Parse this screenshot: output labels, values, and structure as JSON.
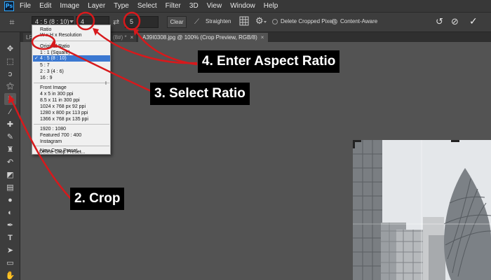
{
  "app": {
    "logo": "Ps"
  },
  "menubar": {
    "items": [
      "File",
      "Edit",
      "Image",
      "Layer",
      "Type",
      "Select",
      "Filter",
      "3D",
      "View",
      "Window",
      "Help"
    ]
  },
  "options": {
    "ratio_value": "4 : 5 (8 : 10)",
    "width_value": "4",
    "height_value": "5",
    "clear_label": "Clear",
    "straighten_label": "Straighten",
    "delete_cropped_label": "Delete Cropped Pixels",
    "content_aware_label": "Content-Aware"
  },
  "tabs": [
    {
      "label": "LR3"
    },
    {
      "label": "(8#) *"
    },
    {
      "label": "A39I0308.jpg @ 100% (Crop Preview, RGB/8)"
    }
  ],
  "dropdown": {
    "header": [
      "Ratio",
      "W x H x Resolution"
    ],
    "ratios": [
      "Original Ratio",
      "1 : 1 (Square)",
      "4 : 5 (8 : 10)",
      "5 : 7",
      "2 : 3 (4 : 6)",
      "16 : 9"
    ],
    "selected_index": 2,
    "sizes": [
      "Front Image",
      "4 x 5 in 300 ppi",
      "8.5 x 11 in 300 ppi",
      "1024 x 768 px 92 ppi",
      "1280 x 800 px 113 ppi",
      "1366 x 768 px 135 ppi"
    ],
    "custom": [
      "1920 : 1080",
      "Featured 700 : 400",
      "Instagram"
    ],
    "actions": [
      "New Crop Preset...",
      "Delete Crop Preset..."
    ]
  },
  "annotations": {
    "step2": "2. Crop",
    "step3": "3. Select Ratio",
    "step4": "4. Enter Aspect Ratio",
    "color": "#d7191c"
  }
}
